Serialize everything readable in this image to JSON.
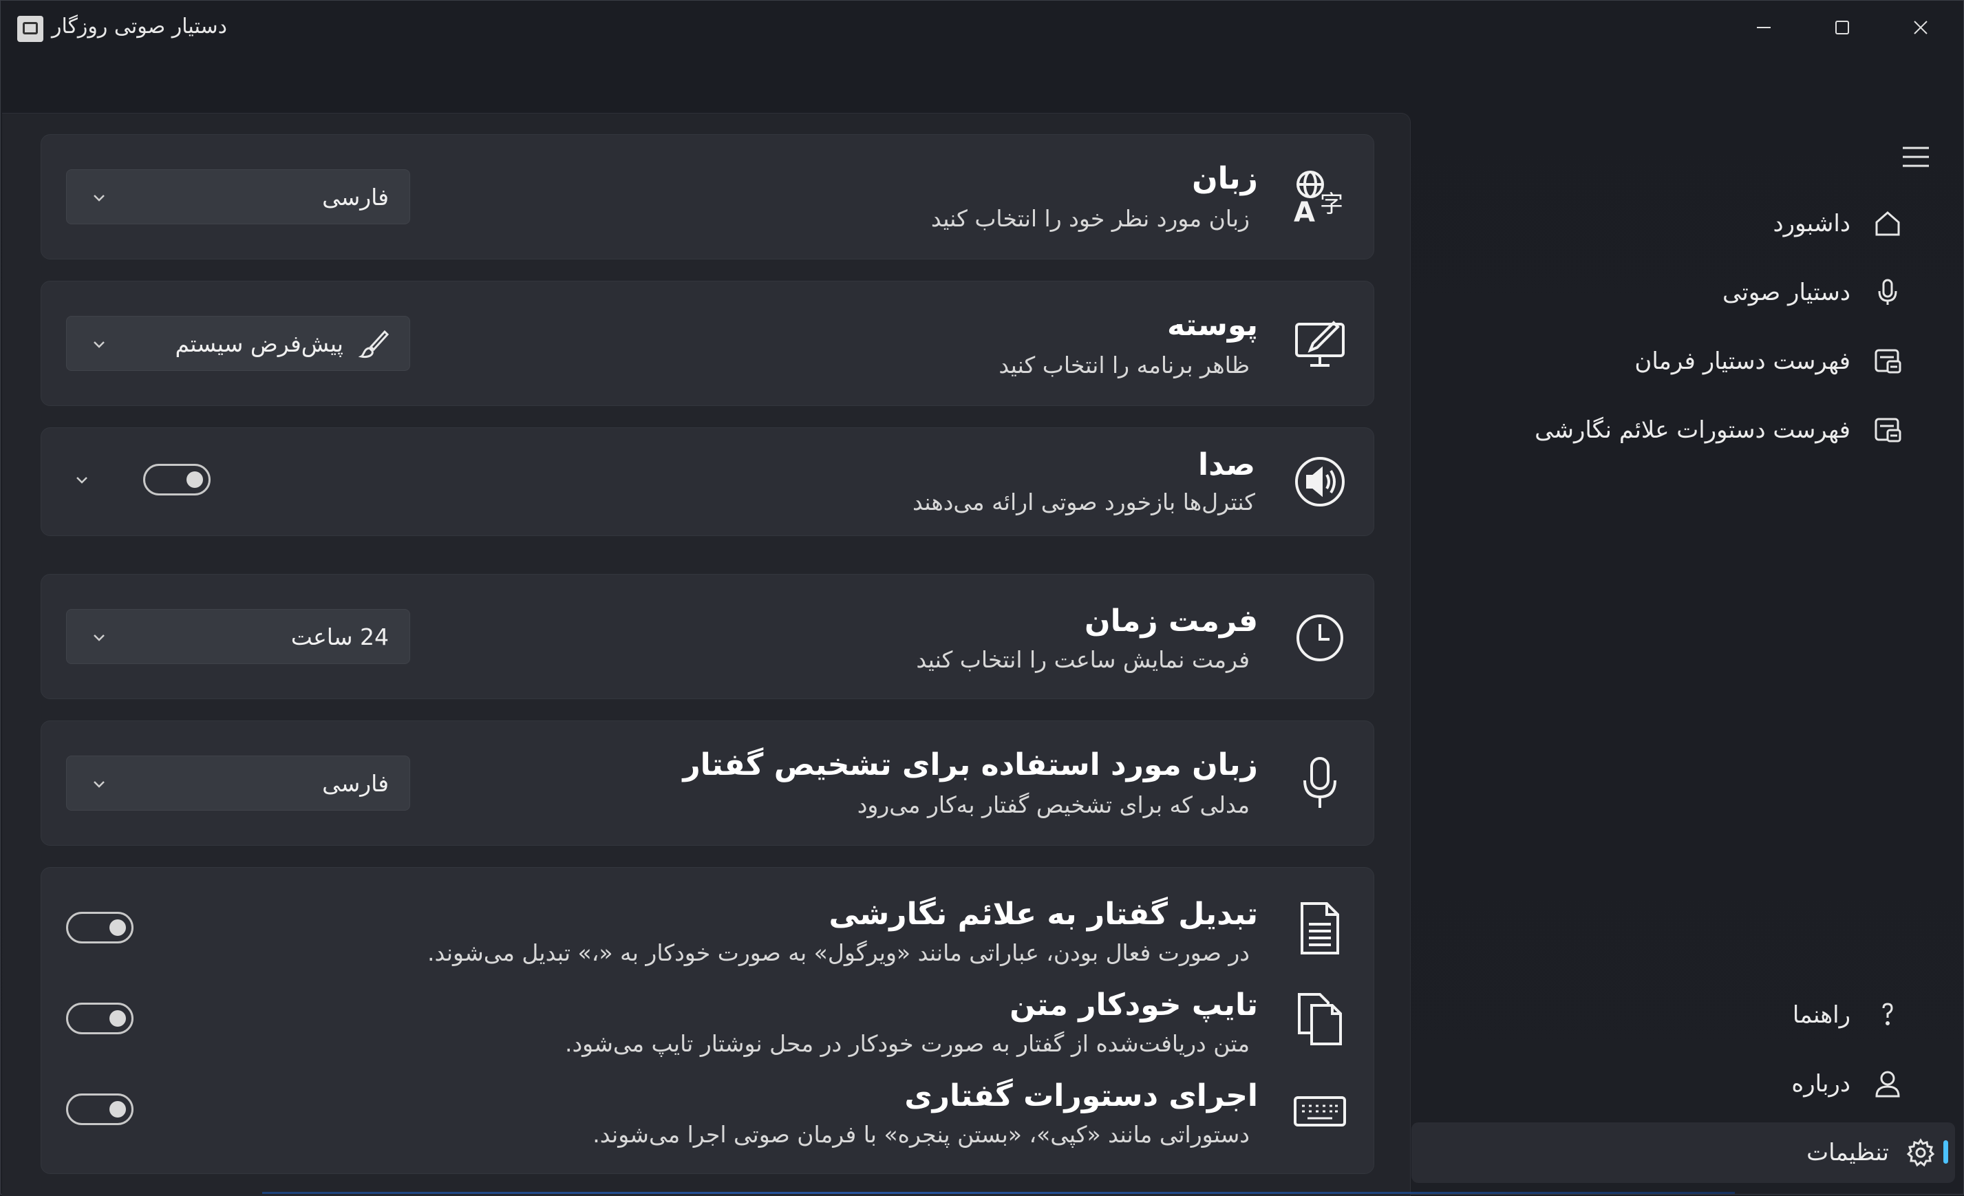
{
  "window": {
    "title": "دستیار صوتی روزگار"
  },
  "settings": {
    "language": {
      "title": "زبان",
      "description": "زبان مورد نظر خود را انتخاب کنید",
      "value": "فارسی",
      "icon": "language-icon"
    },
    "theme": {
      "title": "پوسته",
      "description": "ظاهر برنامه را انتخاب کنید",
      "value": "پیش‌فرض سیستم",
      "icon": "theme-icon"
    },
    "sound": {
      "title": "صدا",
      "description": "کنترل‌ها بازخورد صوتی ارائه می‌دهند",
      "toggle_on": true,
      "icon": "speaker-icon"
    },
    "time_format": {
      "title": "فرمت زمان",
      "description": "فرمت نمایش ساعت را انتخاب کنید",
      "value": "24 ساعت",
      "icon": "clock-icon"
    },
    "speech_language": {
      "title": "زبان مورد استفاده برای تشخیص گفتار",
      "description": "مدلی که برای تشخیص گفتار به‌کار می‌رود",
      "value": "فارسی",
      "icon": "microphone-icon"
    },
    "punctuation": {
      "title": "تبدیل گفتار به علائم نگارشی",
      "description": "در صورت فعال بودن، عباراتی مانند «ویرگول» به صورت خودکار به «،» تبدیل می‌شوند.",
      "toggle_on": true,
      "icon": "document-icon"
    },
    "auto_type": {
      "title": "تایپ خودکار متن",
      "description": "متن دریافت‌شده از گفتار به صورت خودکار در محل نوشتار تایپ می‌شود.",
      "toggle_on": true,
      "icon": "copy-icon"
    },
    "voice_commands": {
      "title": "اجرای دستورات گفتاری",
      "description": "دستوراتی مانند «کپی»، «بستن پنجره» با فرمان صوتی اجرا می‌شوند.",
      "toggle_on": true,
      "icon": "keyboard-icon"
    }
  },
  "nav": {
    "items": [
      {
        "label": "داشبورد",
        "icon": "home-icon"
      },
      {
        "label": "دستیار صوتی",
        "icon": "microphone-icon"
      },
      {
        "label": "فهرست دستیار فرمان",
        "icon": "list-icon"
      },
      {
        "label": "فهرست دستورات علائم نگارشی",
        "icon": "list-icon"
      }
    ],
    "footer": [
      {
        "label": "راهنما",
        "icon": "help-icon"
      },
      {
        "label": "درباره",
        "icon": "person-icon"
      },
      {
        "label": "تنظیمات",
        "icon": "gear-icon",
        "selected": true
      }
    ]
  },
  "colors": {
    "accent": "#4cc2ff",
    "card": "#2c2e35",
    "background": "#1c1e24"
  }
}
